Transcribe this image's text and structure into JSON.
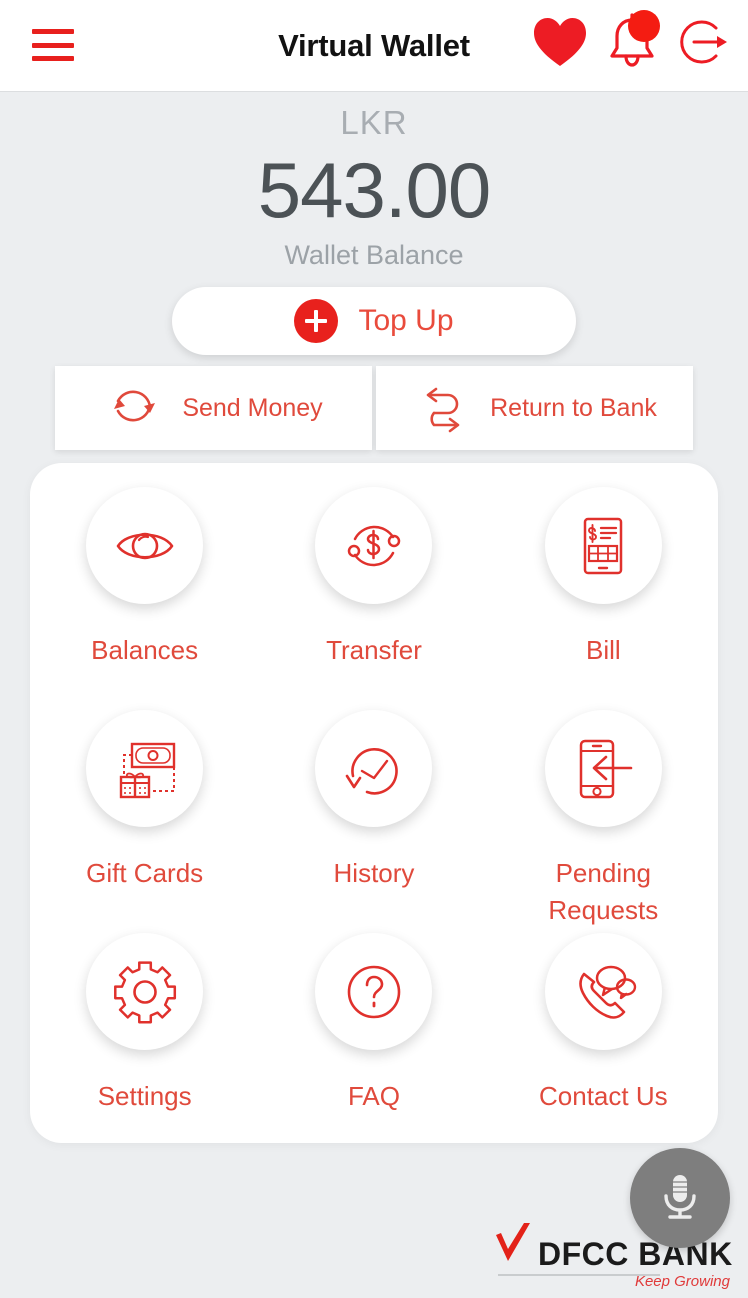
{
  "header": {
    "title": "Virtual Wallet",
    "menu_icon": "hamburger-menu-icon",
    "favorite_icon": "heart-icon",
    "notifications_icon": "bell-icon",
    "notification_badge": true,
    "logout_icon": "logout-icon"
  },
  "balance": {
    "currency": "LKR",
    "amount": "543.00",
    "label": "Wallet Balance"
  },
  "topup": {
    "label": "Top Up",
    "icon": "plus-circle-icon"
  },
  "actions": [
    {
      "label": "Send Money",
      "icon": "refresh-arrows-icon"
    },
    {
      "label": "Return to Bank",
      "icon": "swap-arrows-icon"
    }
  ],
  "grid": [
    {
      "label": "Balances",
      "icon": "eye-icon"
    },
    {
      "label": "Transfer",
      "icon": "dollar-transfer-icon"
    },
    {
      "label": "Bill",
      "icon": "invoice-icon"
    },
    {
      "label": "Gift Cards",
      "icon": "banknote-gift-icon"
    },
    {
      "label": "History",
      "icon": "clock-history-icon"
    },
    {
      "label": "Pending\nRequests",
      "icon": "phone-incoming-icon"
    },
    {
      "label": "Settings",
      "icon": "gear-icon"
    },
    {
      "label": "FAQ",
      "icon": "question-mark-icon"
    },
    {
      "label": "Contact Us",
      "icon": "phone-chat-icon"
    }
  ],
  "footer": {
    "brand": "DFCC BANK",
    "tagline": "Keep Growing",
    "logo_icon": "dfcc-checkmark-icon",
    "mic_icon": "microphone-icon"
  },
  "colors": {
    "brand_red": "#e8211d",
    "label_red": "#e04a3c",
    "page_bg": "#eceef0",
    "card_bg": "#ffffff",
    "amount_text": "#4c5256",
    "muted_text": "#9ca2a7",
    "mic_bg": "#7e7e7e"
  }
}
